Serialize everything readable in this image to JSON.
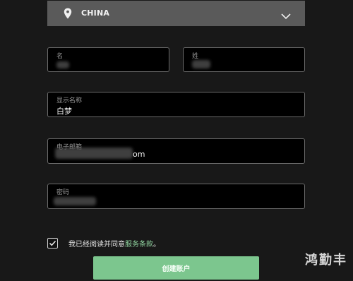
{
  "country": {
    "value": "CHINA"
  },
  "fields": {
    "first_name": {
      "label": "名",
      "value": ""
    },
    "last_name": {
      "label": "姓",
      "value": ""
    },
    "display_name": {
      "label": "显示名称",
      "value": "白梦"
    },
    "email": {
      "label": "电子邮箱",
      "value": "om"
    },
    "password": {
      "label": "密码",
      "value": ""
    }
  },
  "agreement": {
    "checked": true,
    "text": "我已经阅读并同意",
    "link": "服务条款",
    "suffix": "。"
  },
  "submit_label": "创建账户",
  "watermark": "鸿勤丰",
  "colors": {
    "background": "#181818",
    "select": "#5a5a5a",
    "accent": "#7cc68e",
    "link": "#8fd19e"
  }
}
